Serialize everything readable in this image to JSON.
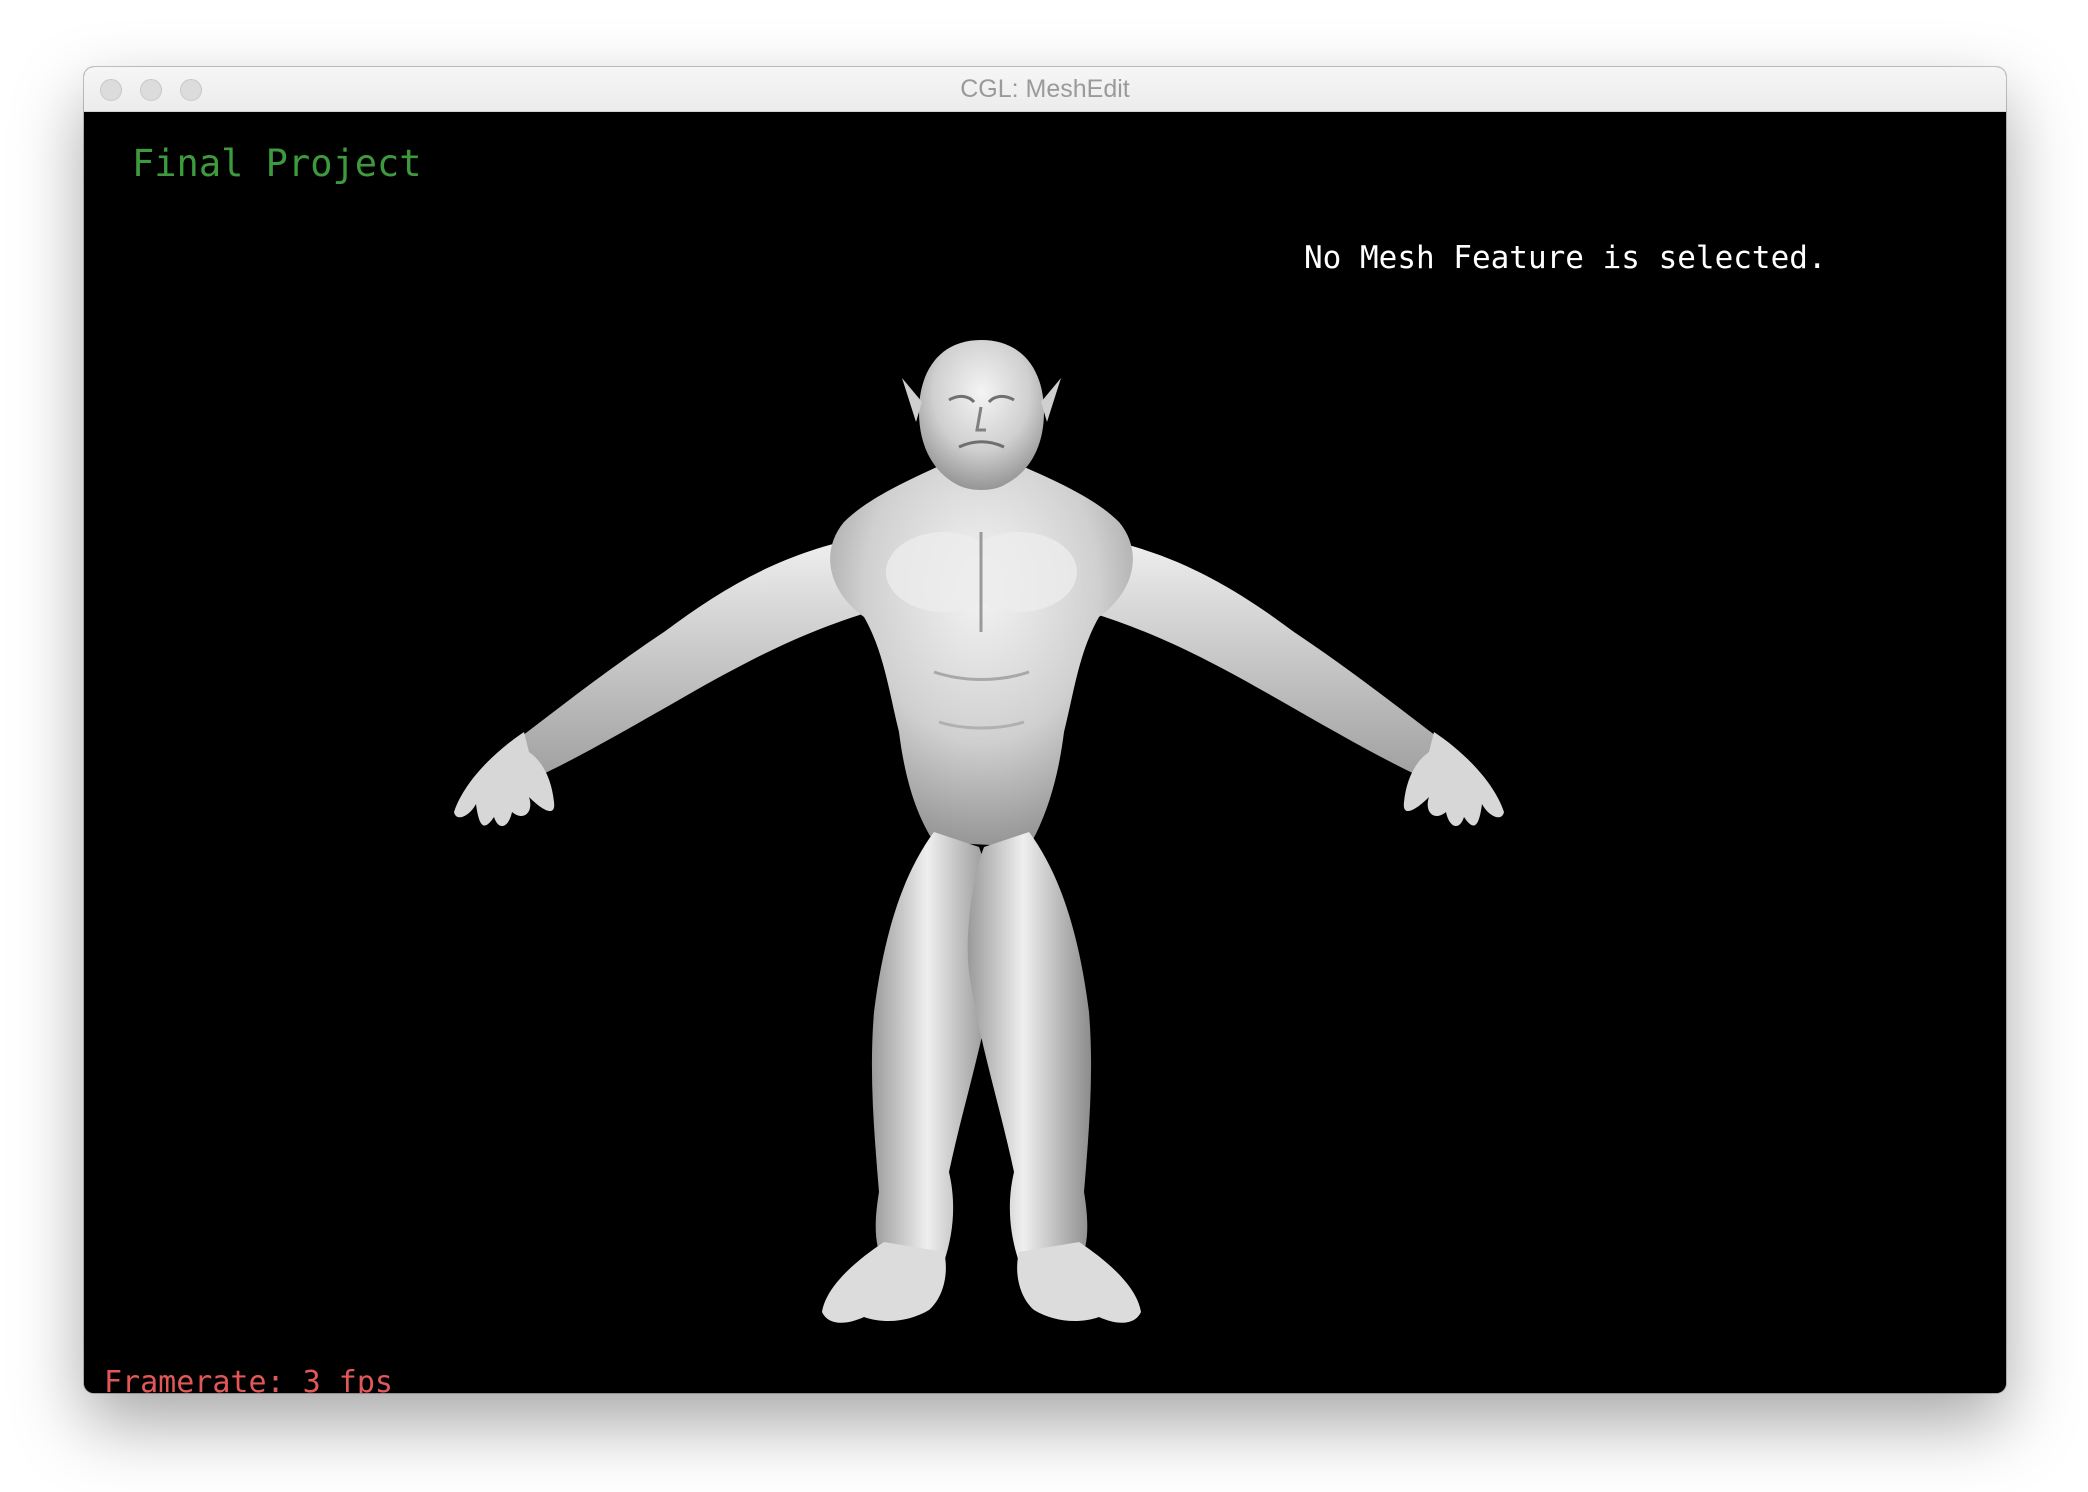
{
  "window": {
    "title": "CGL: MeshEdit",
    "buttons": [
      "close",
      "minimize",
      "zoom"
    ]
  },
  "viewport": {
    "project_label": "Final Project",
    "selection_status": "No Mesh Feature is selected.",
    "framerate": "Framerate: 3 fps",
    "model": "orc-humanoid-mesh"
  },
  "colors": {
    "background": "#000000",
    "project_label": "#3d9a3d",
    "selection_text": "#ffffff",
    "framerate_text": "#e25757",
    "mesh_shading": "#d9d9d9"
  }
}
